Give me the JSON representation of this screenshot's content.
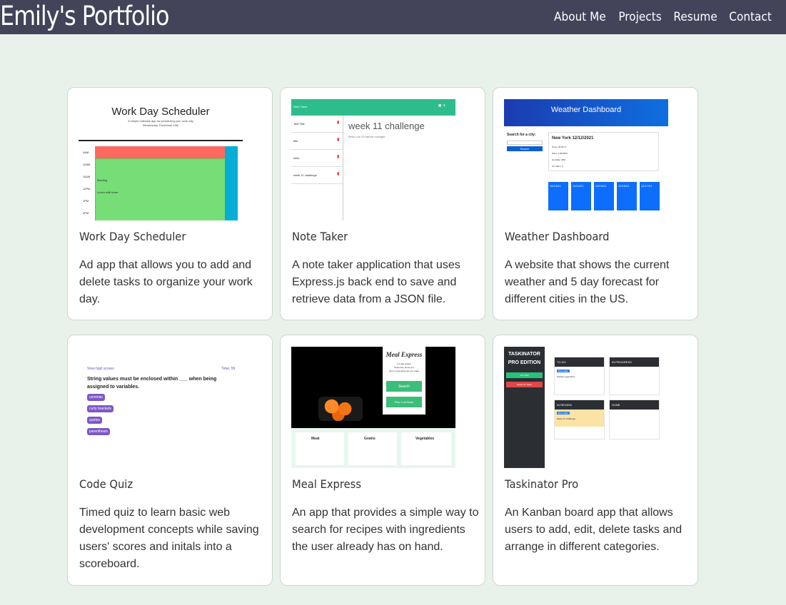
{
  "header": {
    "brand": "Emily's Portfolio",
    "nav": [
      "About Me",
      "Projects",
      "Resume",
      "Contact"
    ],
    "bg_color": "#43435a"
  },
  "projects": [
    {
      "title": "Work Day Scheduler",
      "description": "Ad app that allows you to add and delete tasks to organize your work day.",
      "preview": {
        "heading": "Work Day Scheduler",
        "sub1": "A simple calendar app for scheduling your work day",
        "sub2": "Wednesday, December 15th",
        "hours": [
          "9AM",
          "10AM",
          "11AM",
          "12PM",
          "1PM",
          "2PM"
        ],
        "entries": [
          "Meeting",
          "Lunch with team"
        ]
      }
    },
    {
      "title": "Note Taker",
      "description": "A note taker application that uses Express.js back end to save and retrieve data from a JSON file.",
      "preview": {
        "app_title": "Note Taker",
        "notes": [
          "Test Title",
          "title",
          "hello",
          "week 11 challenge"
        ],
        "note_heading": "week 11 challenge",
        "note_body": "finish Lue 20 before midnight"
      }
    },
    {
      "title": "Weather Dashboard",
      "description": "A website that shows the current weather and 5 day forecast for different cities in the US.",
      "preview": {
        "heading": "Weather Dashboard",
        "search_label": "Search for a city:",
        "search_button": "Search",
        "city": "New York 12/12/2021",
        "current": [
          "Temp: 46.83 °F",
          "Wind: 1.68 MPH",
          "Humidity: 48%",
          "UV Index: 0"
        ],
        "days": [
          "12/13/21",
          "12/14/21",
          "12/15/21",
          "12/16/21",
          "12/17/21"
        ]
      }
    },
    {
      "title": "Code Quiz",
      "description": "Timed quiz to learn basic web development concepts while saving users' scores and initals into a scoreboard.",
      "preview": {
        "link": "View high scores",
        "timer": "Time: 59",
        "question": "String values must be enclosed within ___ when being assigned to variables.",
        "options": [
          "commas",
          "curly brackets",
          "quotes",
          "parenthesis"
        ]
      }
    },
    {
      "title": "Meal Express",
      "description": "An app that provides a simple way to search for recipes with ingredients the user already has on hand.",
      "preview": {
        "logo": "Meal Express",
        "tagline1": "It's that simple",
        "tagline2": "Select key items you",
        "tagline3": "have to see what can you make",
        "search_button": "Search",
        "pick_button": "Pick 3 of these",
        "categories": [
          "Meat",
          "Grains",
          "Vegetables"
        ]
      }
    },
    {
      "title": "Taskinator Pro",
      "description": "An Kanban board app that allows users to add, edit, delete tasks and arrange in different categories.",
      "preview": {
        "sidebar_title": "TASKINATOR PRO EDITION",
        "add_button": "Add Task",
        "delete_button": "Delete All Tasks",
        "columns": [
          "TO DO",
          "IN PROGRESS",
          "IN REVIEW",
          "DONE"
        ],
        "todo_task": "Practice algorithms",
        "review_task": "Week 21 Challenge",
        "badge": "Due today"
      }
    }
  ]
}
